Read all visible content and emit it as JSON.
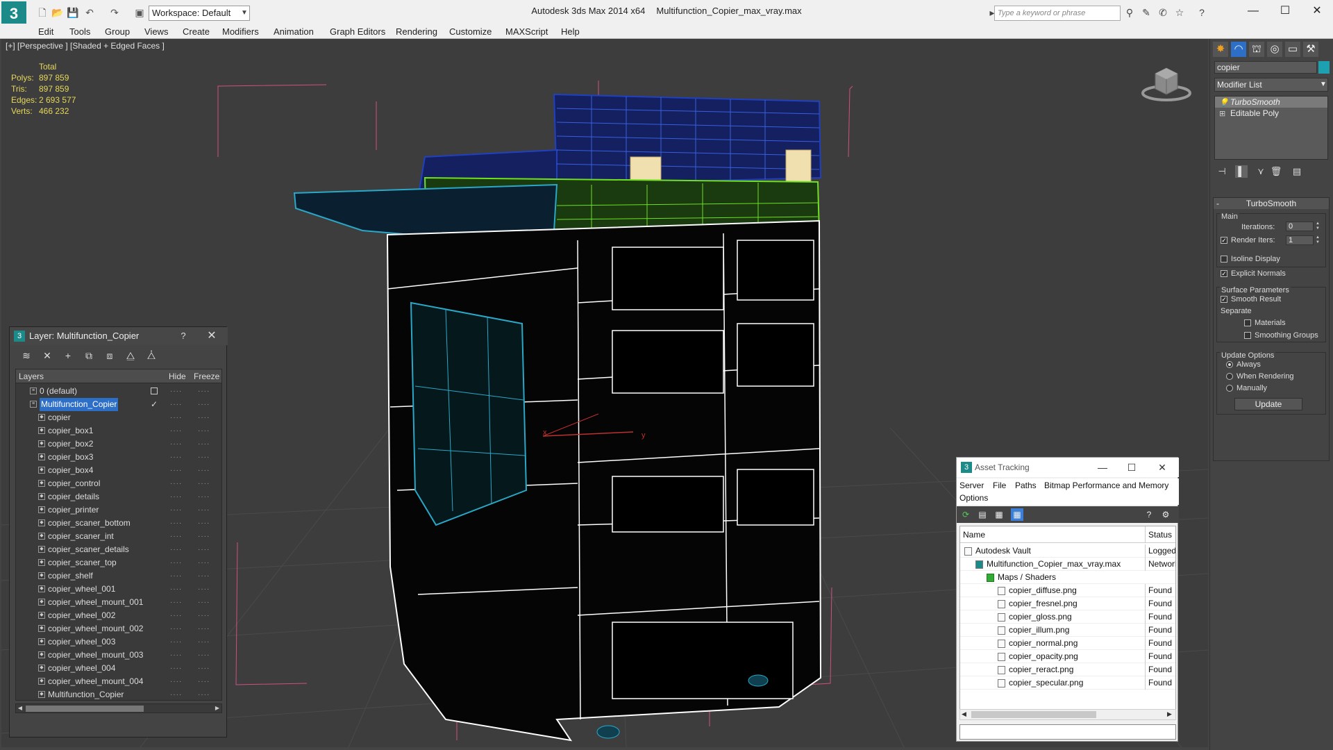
{
  "app": {
    "title": "Autodesk 3ds Max  2014 x64",
    "file": "Multifunction_Copier_max_vray.max",
    "workspace": "Workspace: Default",
    "search_placeholder": "Type a keyword or phrase"
  },
  "menu": [
    "Edit",
    "Tools",
    "Group",
    "Views",
    "Create",
    "Modifiers",
    "Animation",
    "Graph Editors",
    "Rendering",
    "Customize",
    "MAXScript",
    "Help"
  ],
  "viewport": {
    "label": "[+] [Perspective ] [Shaded + Edged Faces ]",
    "stats": {
      "header": "Total",
      "rows": [
        {
          "label": "Polys:",
          "value": "897 859"
        },
        {
          "label": "Tris:",
          "value": "897 859"
        },
        {
          "label": "Edges:",
          "value": "2 693 577"
        },
        {
          "label": "Verts:",
          "value": "466 232"
        }
      ]
    },
    "axis_x": "x",
    "axis_y": "y"
  },
  "command_panel": {
    "object_name": "copier",
    "object_color": "#1da0b0",
    "modifier_list": "Modifier List",
    "stack": [
      {
        "label": "TurboSmooth",
        "selected": true
      },
      {
        "label": "Editable Poly",
        "selected": false
      }
    ],
    "turbosmooth": {
      "title": "TurboSmooth",
      "main_title": "Main",
      "iterations_label": "Iterations:",
      "iterations_value": "0",
      "render_iters_label": "Render Iters:",
      "render_iters_value": "1",
      "isoline_label": "Isoline Display",
      "explicit_normals_label": "Explicit Normals",
      "surface_title": "Surface Parameters",
      "smooth_result_label": "Smooth Result",
      "separate_label": "Separate",
      "materials_label": "Materials",
      "smoothing_groups_label": "Smoothing Groups",
      "update_title": "Update Options",
      "always_label": "Always",
      "when_rendering_label": "When Rendering",
      "manually_label": "Manually",
      "update_button": "Update"
    }
  },
  "layer_dialog": {
    "title": "Layer: Multifunction_Copier",
    "help": "?",
    "columns": {
      "layers": "Layers",
      "hide": "Hide",
      "freeze": "Freeze"
    },
    "rows": [
      {
        "label": "0 (default)",
        "level": 0,
        "selected": false
      },
      {
        "label": "Multifunction_Copier",
        "level": 0,
        "selected": true
      },
      {
        "label": "copier",
        "level": 1,
        "selected": false
      },
      {
        "label": "copier_box1",
        "level": 1,
        "selected": false
      },
      {
        "label": "copier_box2",
        "level": 1,
        "selected": false
      },
      {
        "label": "copier_box3",
        "level": 1,
        "selected": false
      },
      {
        "label": "copier_box4",
        "level": 1,
        "selected": false
      },
      {
        "label": "copier_control",
        "level": 1,
        "selected": false
      },
      {
        "label": "copier_details",
        "level": 1,
        "selected": false
      },
      {
        "label": "copier_printer",
        "level": 1,
        "selected": false
      },
      {
        "label": "copier_scaner_bottom",
        "level": 1,
        "selected": false
      },
      {
        "label": "copier_scaner_int",
        "level": 1,
        "selected": false
      },
      {
        "label": "copier_scaner_details",
        "level": 1,
        "selected": false
      },
      {
        "label": "copier_scaner_top",
        "level": 1,
        "selected": false
      },
      {
        "label": "copier_shelf",
        "level": 1,
        "selected": false
      },
      {
        "label": "copier_wheel_001",
        "level": 1,
        "selected": false
      },
      {
        "label": "copier_wheel_mount_001",
        "level": 1,
        "selected": false
      },
      {
        "label": "copier_wheel_002",
        "level": 1,
        "selected": false
      },
      {
        "label": "copier_wheel_mount_002",
        "level": 1,
        "selected": false
      },
      {
        "label": "copier_wheel_003",
        "level": 1,
        "selected": false
      },
      {
        "label": "copier_wheel_mount_003",
        "level": 1,
        "selected": false
      },
      {
        "label": "copier_wheel_004",
        "level": 1,
        "selected": false
      },
      {
        "label": "copier_wheel_mount_004",
        "level": 1,
        "selected": false
      },
      {
        "label": "Multifunction_Copier",
        "level": 1,
        "selected": false
      }
    ]
  },
  "asset_tracking": {
    "title": "Asset Tracking",
    "menu": [
      "Server",
      "File",
      "Paths",
      "Bitmap Performance and Memory",
      "Options"
    ],
    "columns": {
      "name": "Name",
      "status": "Status"
    },
    "rows": [
      {
        "name": "Autodesk Vault",
        "status": "Logged O",
        "level": 0
      },
      {
        "name": "Multifunction_Copier_max_vray.max",
        "status": "Network",
        "level": 1
      },
      {
        "name": "Maps / Shaders",
        "status": "",
        "level": 2
      },
      {
        "name": "copier_diffuse.png",
        "status": "Found",
        "level": 3
      },
      {
        "name": "copier_fresnel.png",
        "status": "Found",
        "level": 3
      },
      {
        "name": "copier_gloss.png",
        "status": "Found",
        "level": 3
      },
      {
        "name": "copier_illum.png",
        "status": "Found",
        "level": 3
      },
      {
        "name": "copier_normal.png",
        "status": "Found",
        "level": 3
      },
      {
        "name": "copier_opacity.png",
        "status": "Found",
        "level": 3
      },
      {
        "name": "copier_reract.png",
        "status": "Found",
        "level": 3
      },
      {
        "name": "copier_specular.png",
        "status": "Found",
        "level": 3
      }
    ]
  }
}
